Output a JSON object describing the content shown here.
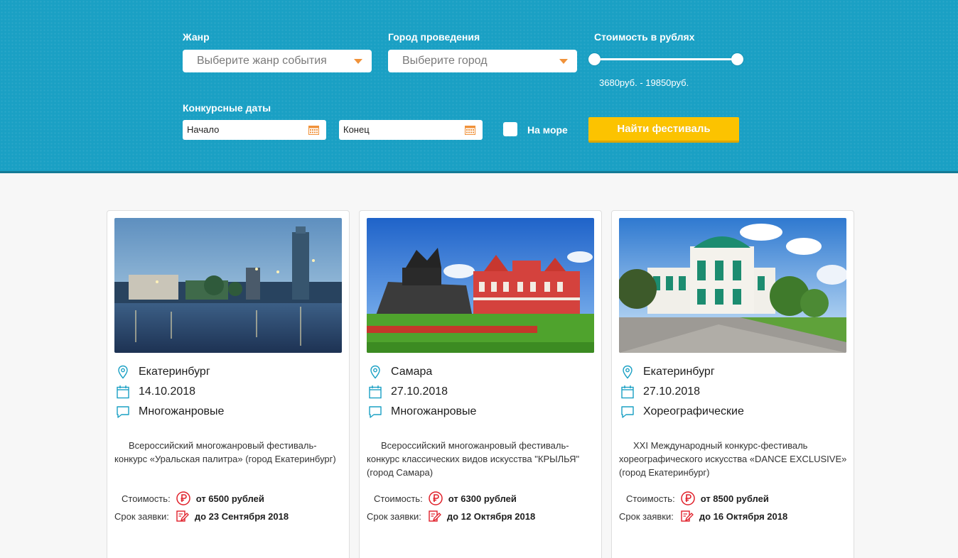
{
  "filters": {
    "genre_label": "Жанр",
    "genre_placeholder": "Выберите жанр события",
    "city_label": "Город проведения",
    "city_placeholder": "Выберите город",
    "price_label": "Стоимость в рублях",
    "price_range": "3680руб. - 19850руб.",
    "price_slider": {
      "min": 3680,
      "max": 19850,
      "low_fraction": 0.0,
      "high_fraction": 1.0
    },
    "dates_label": "Конкурсные даты",
    "start_placeholder": "Начало",
    "end_placeholder": "Конец",
    "sea_label": "На море",
    "sea_checked": false,
    "search_button": "Найти фестиваль"
  },
  "colors": {
    "header_bg": "#1aa0c4",
    "button_bg": "#fcc300",
    "icon_blue": "#1aa0c4",
    "icon_red": "#e0202a",
    "caret": "#f0923a"
  },
  "cards": [
    {
      "city": "Екатеринбург",
      "date": "14.10.2018",
      "genre": "Многожанровые",
      "description": "Всероссийский многожанровый фестиваль-конкурс «Уральская палитра» (город Екатеринбург)",
      "cost_label": "Стоимость:",
      "cost": "от 6500 рублей",
      "deadline_label": "Срок заявки:",
      "deadline": "до 23 Сентября 2018"
    },
    {
      "city": "Самара",
      "date": "27.10.2018",
      "genre": "Многожанровые",
      "description": "Всероссийский многожанровый фестиваль-конкурс классических видов искусства \"КРЫЛЬЯ\" (город Самара)",
      "cost_label": "Стоимость:",
      "cost": "от 6300 рублей",
      "deadline_label": "Срок заявки:",
      "deadline": "до 12 Октября 2018"
    },
    {
      "city": "Екатеринбург",
      "date": "27.10.2018",
      "genre": "Хореографические",
      "description": "XXI Международный конкурс-фестиваль хореографического искусства «DANCE EXCLUSIVE» (город Екатеринбург)",
      "cost_label": "Стоимость:",
      "cost": "от 8500 рублей",
      "deadline_label": "Срок заявки:",
      "deadline": "до 16 Октября 2018"
    }
  ]
}
